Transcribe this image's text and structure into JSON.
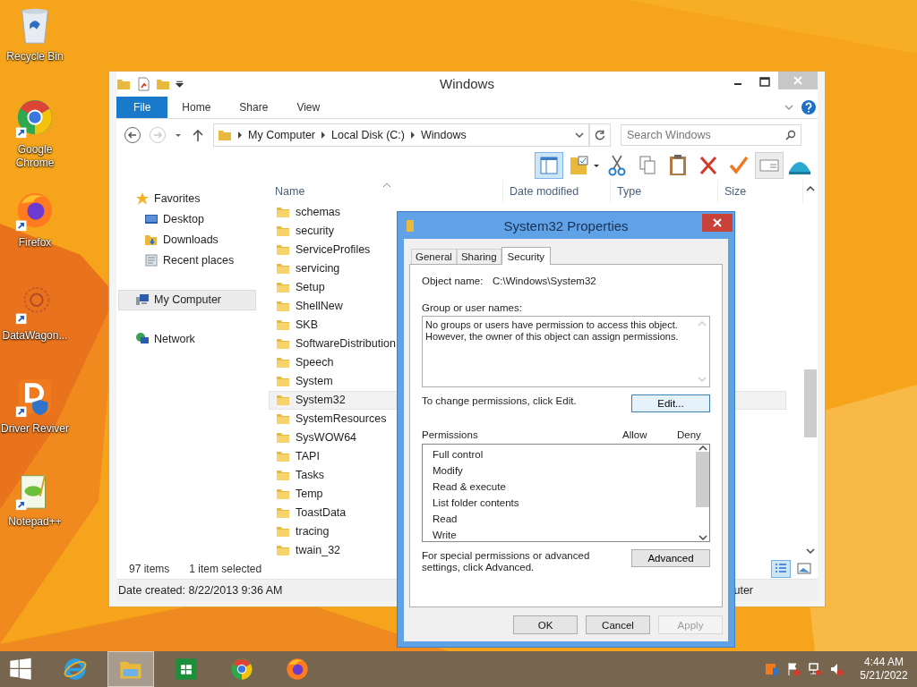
{
  "desktop_icons": [
    {
      "label": "Recycle Bin",
      "kind": "recycle"
    },
    {
      "label": "Google Chrome",
      "kind": "chrome"
    },
    {
      "label": "Firefox",
      "kind": "firefox"
    },
    {
      "label": "DataWagon...",
      "kind": "datawagon"
    },
    {
      "label": "Driver Reviver",
      "kind": "driver"
    },
    {
      "label": "Notepad++",
      "kind": "notepad"
    }
  ],
  "explorer": {
    "title": "Windows",
    "ribbon_tabs": [
      {
        "label": "File",
        "kind": "file",
        "selected": false
      },
      {
        "label": "Home",
        "kind": "tab",
        "selected": false
      },
      {
        "label": "Share",
        "kind": "tab",
        "selected": false
      },
      {
        "label": "View",
        "kind": "tab",
        "selected": false
      }
    ],
    "breadcrumbs": [
      "My Computer",
      "Local Disk (C:)",
      "Windows"
    ],
    "search": {
      "placeholder": "Search Windows"
    },
    "nav": [
      {
        "label": "Favorites",
        "kind": "star",
        "selected": false,
        "children": [
          {
            "label": "Desktop",
            "kind": "desktop",
            "selected": false
          },
          {
            "label": "Downloads",
            "kind": "downloads",
            "selected": false
          },
          {
            "label": "Recent places",
            "kind": "recent",
            "selected": false
          }
        ]
      },
      {
        "label": "My Computer",
        "kind": "computer",
        "selected": true
      },
      {
        "label": "Network",
        "kind": "network",
        "selected": false
      }
    ],
    "columns": [
      "Name",
      "Date modified",
      "Type",
      "Size"
    ],
    "rows": [
      {
        "name": "schemas",
        "selected": false
      },
      {
        "name": "security",
        "selected": false
      },
      {
        "name": "ServiceProfiles",
        "selected": false
      },
      {
        "name": "servicing",
        "selected": false
      },
      {
        "name": "Setup",
        "selected": false
      },
      {
        "name": "ShellNew",
        "selected": false
      },
      {
        "name": "SKB",
        "selected": false
      },
      {
        "name": "SoftwareDistribution",
        "selected": false
      },
      {
        "name": "Speech",
        "selected": false
      },
      {
        "name": "System",
        "selected": false
      },
      {
        "name": "System32",
        "selected": true
      },
      {
        "name": "SystemResources",
        "selected": false
      },
      {
        "name": "SysWOW64",
        "selected": false
      },
      {
        "name": "TAPI",
        "selected": false
      },
      {
        "name": "Tasks",
        "selected": false
      },
      {
        "name": "Temp",
        "selected": false
      },
      {
        "name": "ToastData",
        "selected": false
      },
      {
        "name": "tracing",
        "selected": false
      },
      {
        "name": "twain_32",
        "selected": false
      }
    ],
    "status": {
      "count": "97 items",
      "selection": "1 item selected"
    },
    "details": {
      "date_created": "Date created: 8/22/2013 9:36 AM",
      "location": "uter"
    }
  },
  "dialog": {
    "title": "System32 Properties",
    "tabs": [
      {
        "label": "General",
        "selected": false
      },
      {
        "label": "Sharing",
        "selected": false
      },
      {
        "label": "Security",
        "selected": true
      }
    ],
    "object_label": "Object name:",
    "object_value": "C:\\Windows\\System32",
    "group_label": "Group or user names:",
    "group_lines": [
      "No groups or users have permission to access this object.",
      "However, the owner of this object can assign permissions."
    ],
    "change_text": "To change permissions, click Edit.",
    "edit_button": "Edit...",
    "permissions_label": "Permissions",
    "allow_label": "Allow",
    "deny_label": "Deny",
    "permissions": [
      "Full control",
      "Modify",
      "Read & execute",
      "List folder contents",
      "Read",
      "Write"
    ],
    "advanced_text": "For special permissions or advanced settings, click Advanced.",
    "advanced_button": "Advanced",
    "buttons": [
      {
        "label": "OK",
        "disabled": false
      },
      {
        "label": "Cancel",
        "disabled": false
      },
      {
        "label": "Apply",
        "disabled": true
      }
    ]
  },
  "taskbar": {
    "apps": [
      {
        "kind": "start",
        "selected": false
      },
      {
        "kind": "ie",
        "selected": false
      },
      {
        "kind": "explorer",
        "selected": true
      },
      {
        "kind": "store",
        "selected": false
      },
      {
        "kind": "chrome",
        "selected": false
      },
      {
        "kind": "firefox",
        "selected": false
      }
    ],
    "time": "4:44 AM",
    "date": "5/21/2022"
  }
}
